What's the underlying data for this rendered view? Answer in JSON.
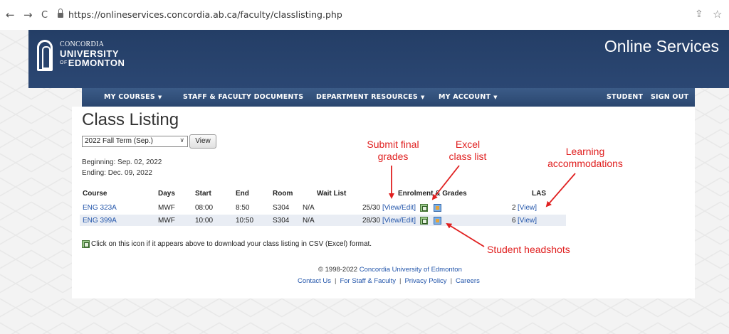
{
  "browser": {
    "back_icon": "←",
    "forward_icon": "→",
    "reload_icon": "C",
    "url": "https://onlineservices.concordia.ab.ca/faculty/classlisting.php",
    "share_icon": "⇪",
    "star_icon": "☆"
  },
  "header": {
    "logo": {
      "line1": "CONCORDIA",
      "line2": "UNIVERSITY",
      "line3_prefix": "OF",
      "line3": "EDMONTON"
    },
    "site_title": "Online Services"
  },
  "nav": {
    "items": [
      {
        "label": "MY COURSES",
        "dropdown": true
      },
      {
        "label": "STAFF & FACULTY DOCUMENTS",
        "dropdown": false
      },
      {
        "label": "DEPARTMENT RESOURCES",
        "dropdown": true
      },
      {
        "label": "MY ACCOUNT",
        "dropdown": true
      },
      {
        "label": "STUDENT",
        "dropdown": false
      },
      {
        "label": "SIGN OUT",
        "dropdown": false
      }
    ],
    "caret": "▼"
  },
  "main": {
    "title": "Class Listing",
    "term_select": {
      "value": "2022 Fall Term (Sep.)",
      "chevron": "∨"
    },
    "view_button": "View",
    "beginning": "Beginning: Sep. 02, 2022",
    "ending": "Ending: Dec. 09, 2022",
    "table": {
      "headers": [
        "Course",
        "Days",
        "Start",
        "End",
        "Room",
        "Wait List",
        "Enrolment & Grades",
        "LAS"
      ],
      "rows": [
        {
          "course": "ENG 323A",
          "days": "MWF",
          "start": "08:00",
          "end": "8:50",
          "room": "S304",
          "wait": "N/A",
          "enrol": "25/30",
          "grades_link": "[View/Edit]",
          "las_count": "2",
          "las_link": "[View]"
        },
        {
          "course": "ENG 399A",
          "days": "MWF",
          "start": "10:00",
          "end": "10:50",
          "room": "S304",
          "wait": "N/A",
          "enrol": "28/30",
          "grades_link": "[View/Edit]",
          "las_count": "6",
          "las_link": "[View]"
        }
      ]
    },
    "csv_note": "Click on this icon if it appears above to download your class listing in CSV (Excel) format."
  },
  "footer": {
    "copyright": "© 1998-2022",
    "org_link": "Concordia University of Edmonton",
    "links": [
      "Contact Us",
      "For Staff & Faculty",
      "Privacy Policy",
      "Careers"
    ],
    "separator": "|"
  },
  "annotations": {
    "submit": [
      "Submit final",
      "grades"
    ],
    "excel": [
      "Excel",
      "class list"
    ],
    "learning": [
      "Learning",
      "accommodations"
    ],
    "headshots": "Student headshots",
    "color": "#e02020"
  }
}
